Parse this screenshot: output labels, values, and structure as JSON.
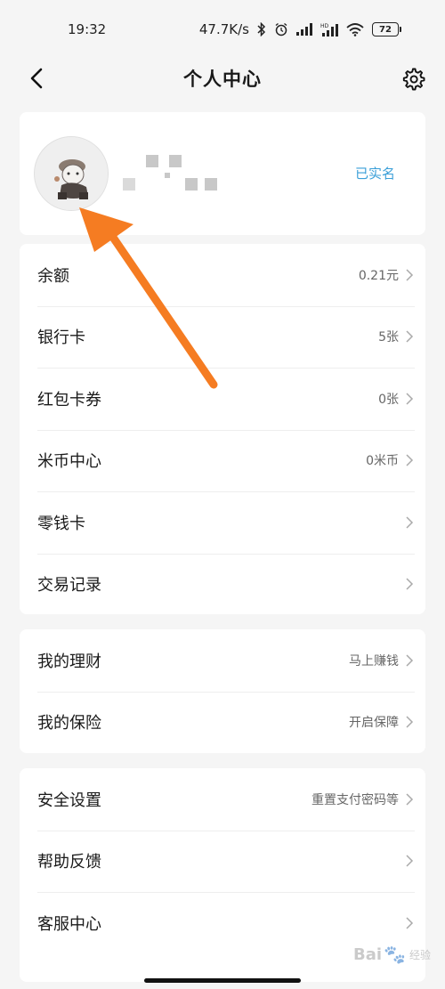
{
  "status_bar": {
    "time": "19:32",
    "network_speed": "47.7K/s",
    "battery": "72",
    "icons": [
      "bluetooth-icon",
      "alarm-icon",
      "signal-icon",
      "hd-signal-icon",
      "wifi-icon",
      "battery-icon"
    ]
  },
  "header": {
    "title": "个人中心",
    "back_icon": "chevron-left-icon",
    "settings_icon": "gear-icon"
  },
  "profile": {
    "verified_label": "已实名"
  },
  "wallet_section": {
    "items": [
      {
        "label": "余额",
        "value": "0.21元"
      },
      {
        "label": "银行卡",
        "value": "5张"
      },
      {
        "label": "红包卡券",
        "value": "0张"
      },
      {
        "label": "米币中心",
        "value": "0米币"
      },
      {
        "label": "零钱卡",
        "value": ""
      },
      {
        "label": "交易记录",
        "value": ""
      }
    ]
  },
  "finance_section": {
    "items": [
      {
        "label": "我的理财",
        "value": "马上赚钱"
      },
      {
        "label": "我的保险",
        "value": "开启保障"
      }
    ]
  },
  "service_section": {
    "items": [
      {
        "label": "安全设置",
        "value": "重置支付密码等"
      },
      {
        "label": "帮助反馈",
        "value": ""
      },
      {
        "label": "客服中心",
        "value": ""
      }
    ]
  },
  "watermark": {
    "brand": "Bai",
    "brand2": "经验",
    "paw": "🐾"
  },
  "colors": {
    "accent": "#3a9fd8",
    "arrow": "#f57c22",
    "background": "#f5f5f5"
  }
}
